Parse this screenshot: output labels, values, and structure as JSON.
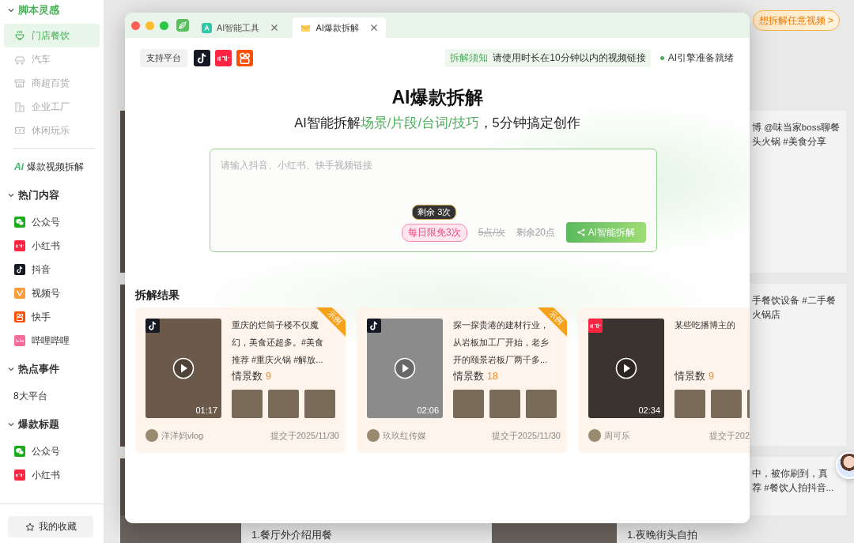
{
  "sidebar": {
    "entries": [
      {
        "kind": "section",
        "title": "脚本灵感",
        "active": true,
        "expanded": true,
        "items": [
          {
            "label": "门店餐饮",
            "kind": "bowl",
            "selected": true
          },
          {
            "label": "汽车",
            "kind": "car",
            "selected": false
          },
          {
            "label": "商超百货",
            "kind": "store",
            "selected": false
          },
          {
            "label": "企业工厂",
            "kind": "factory",
            "selected": false
          },
          {
            "label": "休闲玩乐",
            "kind": "ticket",
            "selected": false
          }
        ]
      },
      {
        "kind": "link",
        "mark": "Ai",
        "label": "爆款视频拆解"
      },
      {
        "kind": "section",
        "title": "热门内容",
        "active": false,
        "expanded": true,
        "items": [
          {
            "label": "公众号",
            "kind": "wechat",
            "selected": false
          },
          {
            "label": "小红书",
            "kind": "xiaohongshu",
            "selected": false
          },
          {
            "label": "抖音",
            "kind": "douyin",
            "selected": false
          },
          {
            "label": "视频号",
            "kind": "channels",
            "selected": false
          },
          {
            "label": "快手",
            "kind": "kuaishou",
            "selected": false
          },
          {
            "label": "哔哩哔哩",
            "kind": "bilibili",
            "selected": false
          }
        ]
      },
      {
        "kind": "section",
        "title": "热点事件",
        "active": false,
        "expanded": true,
        "items": [
          {
            "label": "8大平台",
            "kind": "plain",
            "selected": false
          }
        ]
      },
      {
        "kind": "section",
        "title": "爆款标题",
        "active": false,
        "expanded": true,
        "items": [
          {
            "label": "公众号",
            "kind": "wechat",
            "selected": false
          },
          {
            "label": "小红书",
            "kind": "xiaohongshu",
            "selected": false
          }
        ]
      }
    ],
    "favorites_button": "我的收藏"
  },
  "background": {
    "cta": "想拆解任意视频 >",
    "right_cards": [
      {
        "lines": [
          "博 @味当家boss聊餐",
          "头火锅 #美食分享"
        ]
      },
      {
        "lines": [
          "手餐饮设备 #二手餐",
          "火锅店"
        ]
      },
      {
        "lines": [
          "中，被你刷到，真",
          "荐 #餐饮人拍抖音..."
        ]
      }
    ],
    "bottom_items": [
      "1.餐厅外介绍用餐",
      "1.夜晚街头自拍"
    ]
  },
  "window": {
    "tabs": [
      {
        "label": "AI智能工具",
        "kind": "ai",
        "selected": false
      },
      {
        "label": "AI爆款拆解",
        "kind": "mail",
        "selected": true
      }
    ],
    "toolbar": {
      "platforms_label": "支持平台",
      "platforms": [
        {
          "kind": "douyin"
        },
        {
          "kind": "xiaohongshu"
        },
        {
          "kind": "kuaishou"
        }
      ],
      "notice_label": "拆解须知",
      "notice": "请使用时长在10分钟以内的视频链接",
      "status": "AI引擎准备就绪",
      "ready": true
    },
    "hero": {
      "title": "AI爆款拆解",
      "subtitle": {
        "before": "AI智能拆解",
        "highlight": "场景/片段/台词/技巧",
        "after": "，5分钟搞定创作"
      }
    },
    "input": {
      "placeholder": "请输入抖音、小红书、快手视频链接",
      "tooltip": "剩余 3次",
      "free_badge": "每日限免3次",
      "price": "5点/次",
      "price_struck": true,
      "balance": "剩余20点",
      "submit": "AI智能拆解"
    },
    "results": {
      "title": "拆解结果",
      "cards": [
        {
          "kind": "douyin",
          "duration": "01:17",
          "title": "重庆的烂筒子楼不仅魔幻，美食还超多。#美食推荐 #重庆火锅 #解放...",
          "scenes_label": "情景数",
          "scenes": "9",
          "author": "洋洋妈vlog",
          "date": "提交于2025/11/30",
          "badge": "示例"
        },
        {
          "kind": "douyin",
          "duration": "02:06",
          "title": "探一探贵港的建材行业，从岩板加工厂开始，老乡开的颐景岩板厂两千多...",
          "scenes_label": "情景数",
          "scenes": "18",
          "author": "玖玖红传媒",
          "date": "提交于2025/11/30",
          "badge": "示例"
        },
        {
          "kind": "xiaohongshu",
          "duration": "02:34",
          "title": "某些吃播博主的",
          "scenes_label": "情景数",
          "scenes": "9",
          "author": "周可乐",
          "date": "提交于202"
        }
      ]
    }
  }
}
